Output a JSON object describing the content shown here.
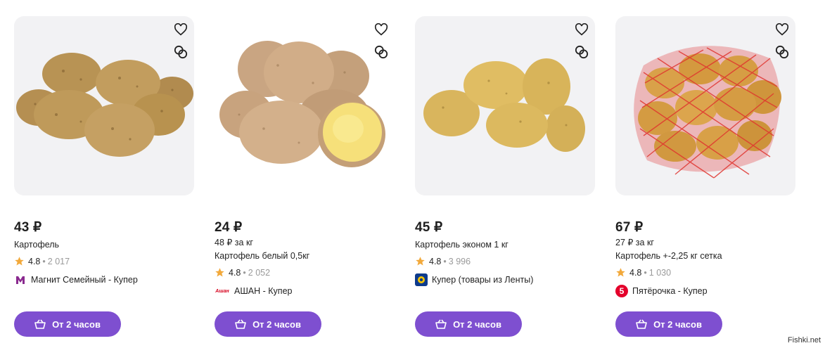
{
  "products": [
    {
      "price": "43 ₽",
      "per_kg": "",
      "name": "Картофель",
      "rating": "4.8",
      "reviews": "2 017",
      "store": "Магнит Семейный - Купер",
      "store_logo": "magnit-logo",
      "button": "От 2 часов"
    },
    {
      "price": "24 ₽",
      "per_kg": "48 ₽ за кг",
      "name": "Картофель белый 0,5кг",
      "rating": "4.8",
      "reviews": "2 052",
      "store": "АШАН - Купер",
      "store_logo": "auchan-logo",
      "button": "От 2 часов"
    },
    {
      "price": "45 ₽",
      "per_kg": "",
      "name": "Картофель эконом 1 кг",
      "rating": "4.8",
      "reviews": "3 996",
      "store": "Купер (товары из Ленты)",
      "store_logo": "lenta-logo",
      "button": "От 2 часов"
    },
    {
      "price": "67 ₽",
      "per_kg": "27 ₽ за кг",
      "name": "Картофель +-2,25 кг сетка",
      "rating": "4.8",
      "reviews": "1 030",
      "store": "Пятёрочка - Купер",
      "store_logo": "pyaterochka-logo",
      "button": "От 2 часов"
    }
  ],
  "auchan_logo_text": "Ашан",
  "pyaterochka_logo_text": "5",
  "watermark": "Fishki.net",
  "colors": {
    "accent": "#7e4fd0",
    "star": "#f2a93b",
    "card_bg": "#f2f2f4",
    "muted": "#9a9a9a"
  }
}
